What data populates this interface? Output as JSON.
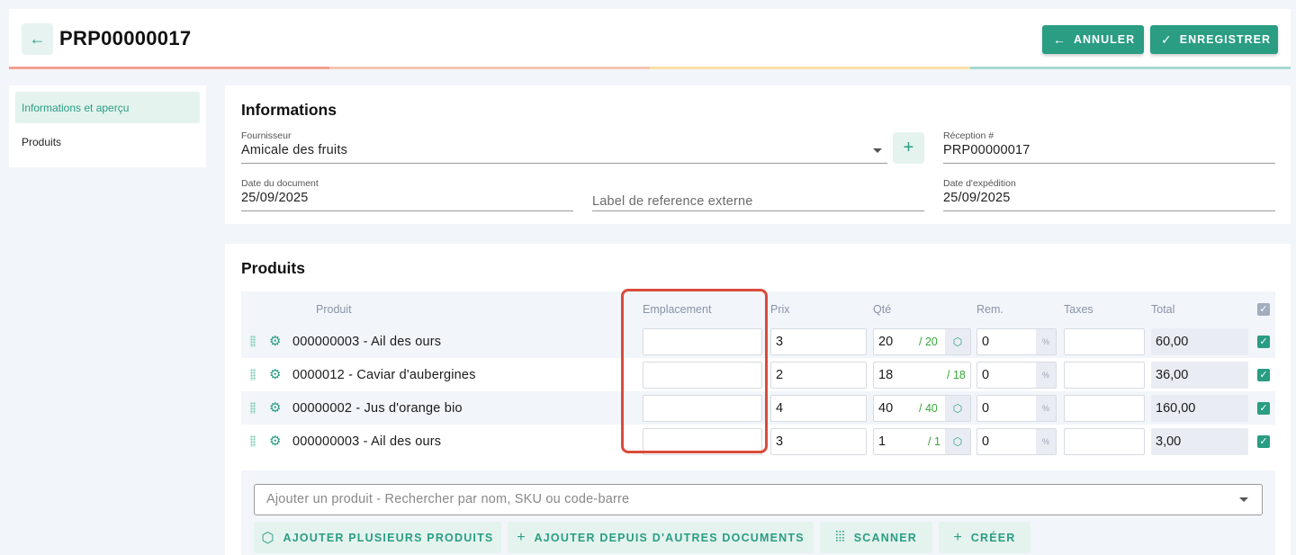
{
  "header": {
    "back_icon": "arrow-left-icon",
    "title": "PRP00000017",
    "cancel_label": "ANNULER",
    "save_label": "ENREGISTRER",
    "progress_colors": [
      "#f2a08e",
      "#f6c6b2",
      "#f8dfa6",
      "#a6d9d0"
    ]
  },
  "sidebar": {
    "items": [
      {
        "label": "Informations et aperçu",
        "active": true
      },
      {
        "label": "Produits",
        "active": false
      }
    ]
  },
  "info": {
    "title": "Informations",
    "supplier_label": "Fournisseur",
    "supplier_value": "Amicale des fruits",
    "reception_label": "Réception #",
    "reception_value": "PRP00000017",
    "doc_date_label": "Date du document",
    "doc_date_value": "25/09/2025",
    "external_ref_placeholder": "Label de reference externe",
    "ship_date_label": "Date d'expédition",
    "ship_date_value": "25/09/2025"
  },
  "products": {
    "title": "Produits",
    "columns": {
      "product": "Produit",
      "location": "Emplacement",
      "price": "Prix",
      "qty": "Qté",
      "discount": "Rem.",
      "taxes": "Taxes",
      "total": "Total"
    },
    "rows": [
      {
        "name": "000000003 - Ail des ours",
        "location": "",
        "price": "3",
        "qty": "20",
        "qty_cap": "/ 20",
        "has_box": true,
        "discount": "0",
        "pct": "%",
        "taxes": "",
        "total": "60,00"
      },
      {
        "name": "0000012 - Caviar d'aubergines",
        "location": "",
        "price": "2",
        "qty": "18",
        "qty_cap": "/ 18",
        "has_box": false,
        "discount": "0",
        "pct": "%",
        "taxes": "",
        "total": "36,00"
      },
      {
        "name": "00000002 - Jus d'orange bio",
        "location": "",
        "price": "4",
        "qty": "40",
        "qty_cap": "/ 40",
        "has_box": true,
        "discount": "0",
        "pct": "%",
        "taxes": "",
        "total": "160,00"
      },
      {
        "name": "000000003 - Ail des ours",
        "location": "",
        "price": "3",
        "qty": "1",
        "qty_cap": "/ 1",
        "has_box": true,
        "discount": "0",
        "pct": "%",
        "taxes": "",
        "total": "3,00"
      }
    ],
    "search_placeholder": "Ajouter un produit - Rechercher par nom, SKU ou code-barre",
    "actions": {
      "add_multiple": "AJOUTER PLUSIEURS PRODUITS",
      "add_from_docs": "AJOUTER DEPUIS D'AUTRES DOCUMENTS",
      "scan": "SCANNER",
      "create": "CRÉER"
    }
  },
  "colors": {
    "accent": "#2a9d83",
    "highlight": "#d94c3a",
    "qty_green": "#37a53a"
  }
}
